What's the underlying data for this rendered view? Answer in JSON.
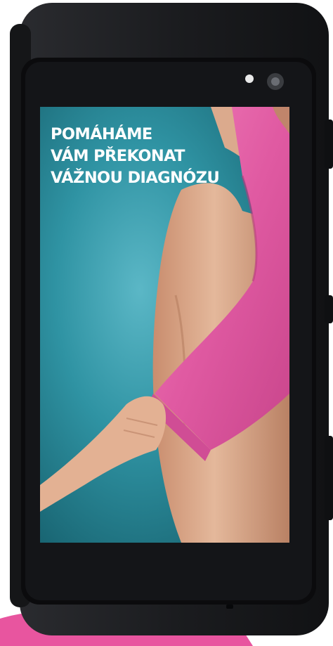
{
  "headline": {
    "lines": [
      "POMÁHÁME",
      "VÁM PŘEKONAT",
      "VÁŽNOU DIAGNÓZU"
    ]
  },
  "colors": {
    "phone_body": "#1c1d20",
    "screen_bezel": "#0d0d0f",
    "background_teal": "#1f7e8e",
    "background_teal_light": "#5bb7c6",
    "ribbon_pink": "#e35fa5",
    "skin": "#d9a98c",
    "headline_text": "#ffffff"
  },
  "image": {
    "subject": "advert on smartphone screen: pink ribbon draped over a torso, a hand holding the ribbon end"
  }
}
